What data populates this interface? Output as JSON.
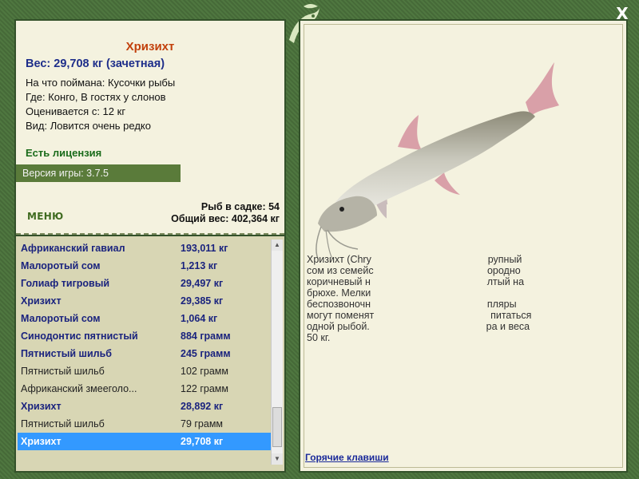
{
  "fish": {
    "title": "Хризихт",
    "weight_line": "Вес: 29,708 кг (зачетная)",
    "bait_line": "На что поймана: Кусочки рыбы",
    "place_line": "Где: Конго, В гостях у слонов",
    "rated_line": "Оценивается с: 12 кг",
    "kind_line": "Вид: Ловится очень редко"
  },
  "license": "Есть лицензия",
  "version": "Версия игры: 3.7.5",
  "menu_label": "МЕНЮ",
  "stats": {
    "count_line": "Рыб в садке: 54",
    "total_line": "Общий вес: 402,364 кг"
  },
  "catches": [
    {
      "name": "Африканский гавиал",
      "weight": "193,011 кг",
      "style": "bold"
    },
    {
      "name": "Малоротый сом",
      "weight": "1,213 кг",
      "style": "bold"
    },
    {
      "name": "Голиаф тигровый",
      "weight": "29,497 кг",
      "style": "bold"
    },
    {
      "name": "Хризихт",
      "weight": "29,385 кг",
      "style": "bold"
    },
    {
      "name": "Малоротый сом",
      "weight": "1,064 кг",
      "style": "bold"
    },
    {
      "name": "Синодонтис пятнистый",
      "weight": "884 грамм",
      "style": "bold"
    },
    {
      "name": "Пятнистый шильб",
      "weight": "245 грамм",
      "style": "bold"
    },
    {
      "name": "Пятнистый шильб",
      "weight": "102 грамм",
      "style": "plain"
    },
    {
      "name": "Африканский змееголо...",
      "weight": "122 грамм",
      "style": "plain"
    },
    {
      "name": "Хризихт",
      "weight": "28,892 кг",
      "style": "bold"
    },
    {
      "name": "Пятнистый шильб",
      "weight": "79 грамм",
      "style": "plain"
    },
    {
      "name": "Хризихт",
      "weight": "29,708 кг",
      "style": "sel"
    }
  ],
  "description": [
    "Хризихт (Chry                                          рупный",
    "сом из семейс                                         ородно",
    "коричневый н                                          лтый на",
    "брюхе. Мелки",
    "беспозвоночн                                          пляры",
    "могут поменят                                          питаться",
    "одной рыбой.                                          ра и веса",
    "50 кг."
  ],
  "hotkeys": "Горячие клавиши",
  "close_label": "X",
  "icons": {
    "close": "close-icon",
    "logo": "fish-logo-icon"
  },
  "colors": {
    "frame": "#4a6f3a",
    "panel": "#f4f2df",
    "title": "#c2410c",
    "link": "#1a237e",
    "selected": "#3399ff"
  }
}
